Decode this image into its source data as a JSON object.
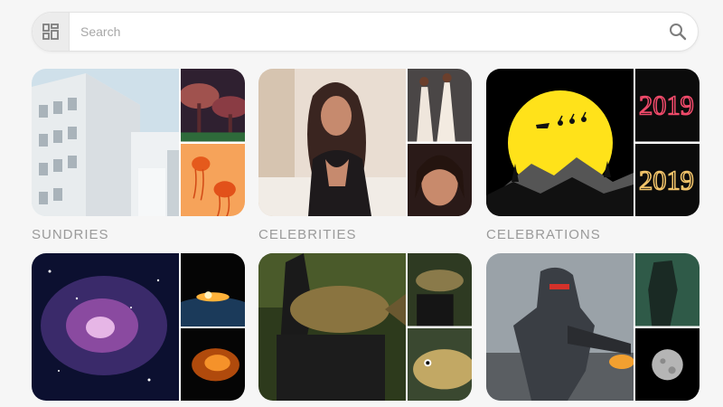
{
  "search": {
    "placeholder": "Search"
  },
  "categories": [
    {
      "label": "SUNDRIES"
    },
    {
      "label": "CELEBRITIES"
    },
    {
      "label": "CELEBRATIONS"
    }
  ],
  "colors": {
    "background": "#f6f6f6",
    "label_text": "#9a9a9a",
    "icon_gray": "#7d7d7d"
  }
}
